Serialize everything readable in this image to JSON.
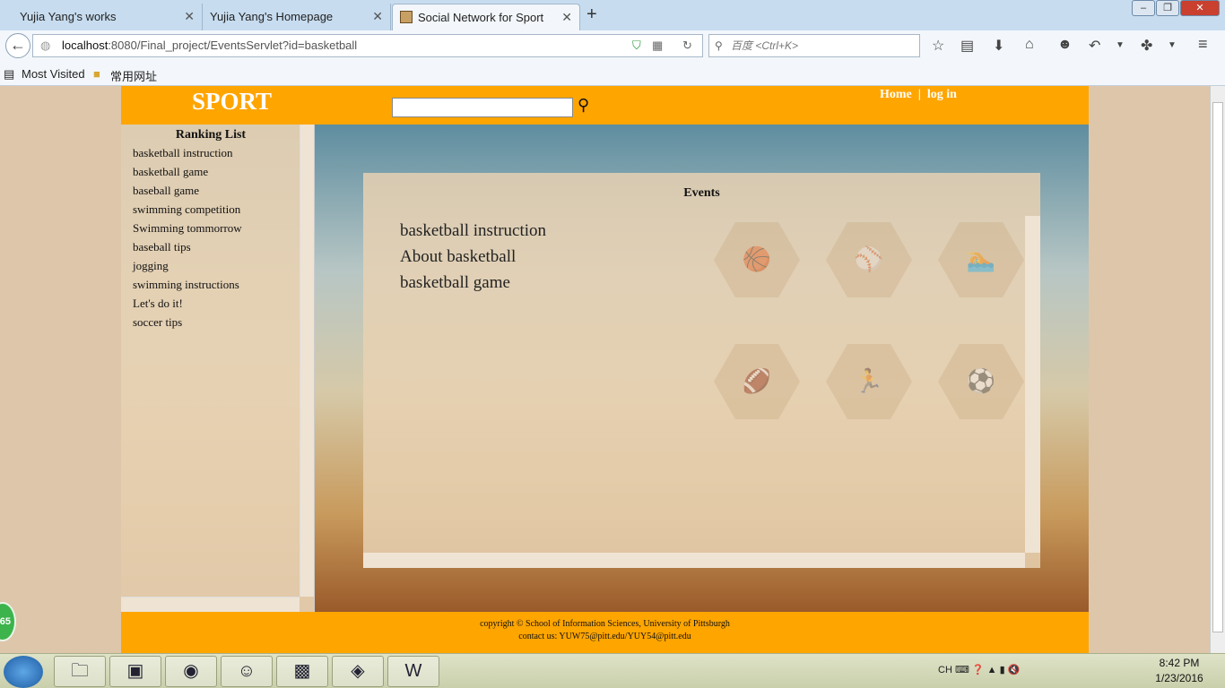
{
  "browser": {
    "tabs": [
      {
        "title": "Yujia Yang's works",
        "active": false
      },
      {
        "title": "Yujia Yang's Homepage",
        "active": false
      },
      {
        "title": "Social Network for Sport",
        "active": true
      }
    ],
    "new_tab_icon": "plus-icon",
    "url_host": "localhost",
    "url_rest": ":8080/Final_project/EventsServlet?id=basketball",
    "search_placeholder": "百度 <Ctrl+K>",
    "bookmarks": [
      "Most Visited",
      "常用网址"
    ]
  },
  "site": {
    "logo": "SPORT",
    "search_value": "",
    "nav_home": "Home",
    "nav_sep": "|",
    "nav_login": "log in",
    "ranking_title": "Ranking List",
    "ranking_items": [
      "basketball instruction",
      "basketball game",
      "baseball game",
      "swimming competition",
      "Swimming tommorrow",
      "baseball tips",
      "jogging",
      "swimming instructions",
      "Let's do it!",
      "soccer tips"
    ],
    "events_title": "Events",
    "events": [
      "basketball instruction",
      "About basketball",
      "basketball game"
    ],
    "category_icons": [
      "basketball-icon",
      "baseball-icon",
      "swimming-icon",
      "football-icon",
      "running-icon",
      "soccer-icon"
    ],
    "footer_copyright": "copyright © School of Information Sciences, University of Pittsburgh",
    "footer_contact": "contact us: YUW75@pitt.edu/YUY54@pitt.edu"
  },
  "taskbar": {
    "tray_lang": "CH",
    "time": "8:42 PM",
    "date": "1/23/2016",
    "badge": "65"
  },
  "colors": {
    "accent": "#ffa500",
    "page_bg": "#dec6ab"
  }
}
